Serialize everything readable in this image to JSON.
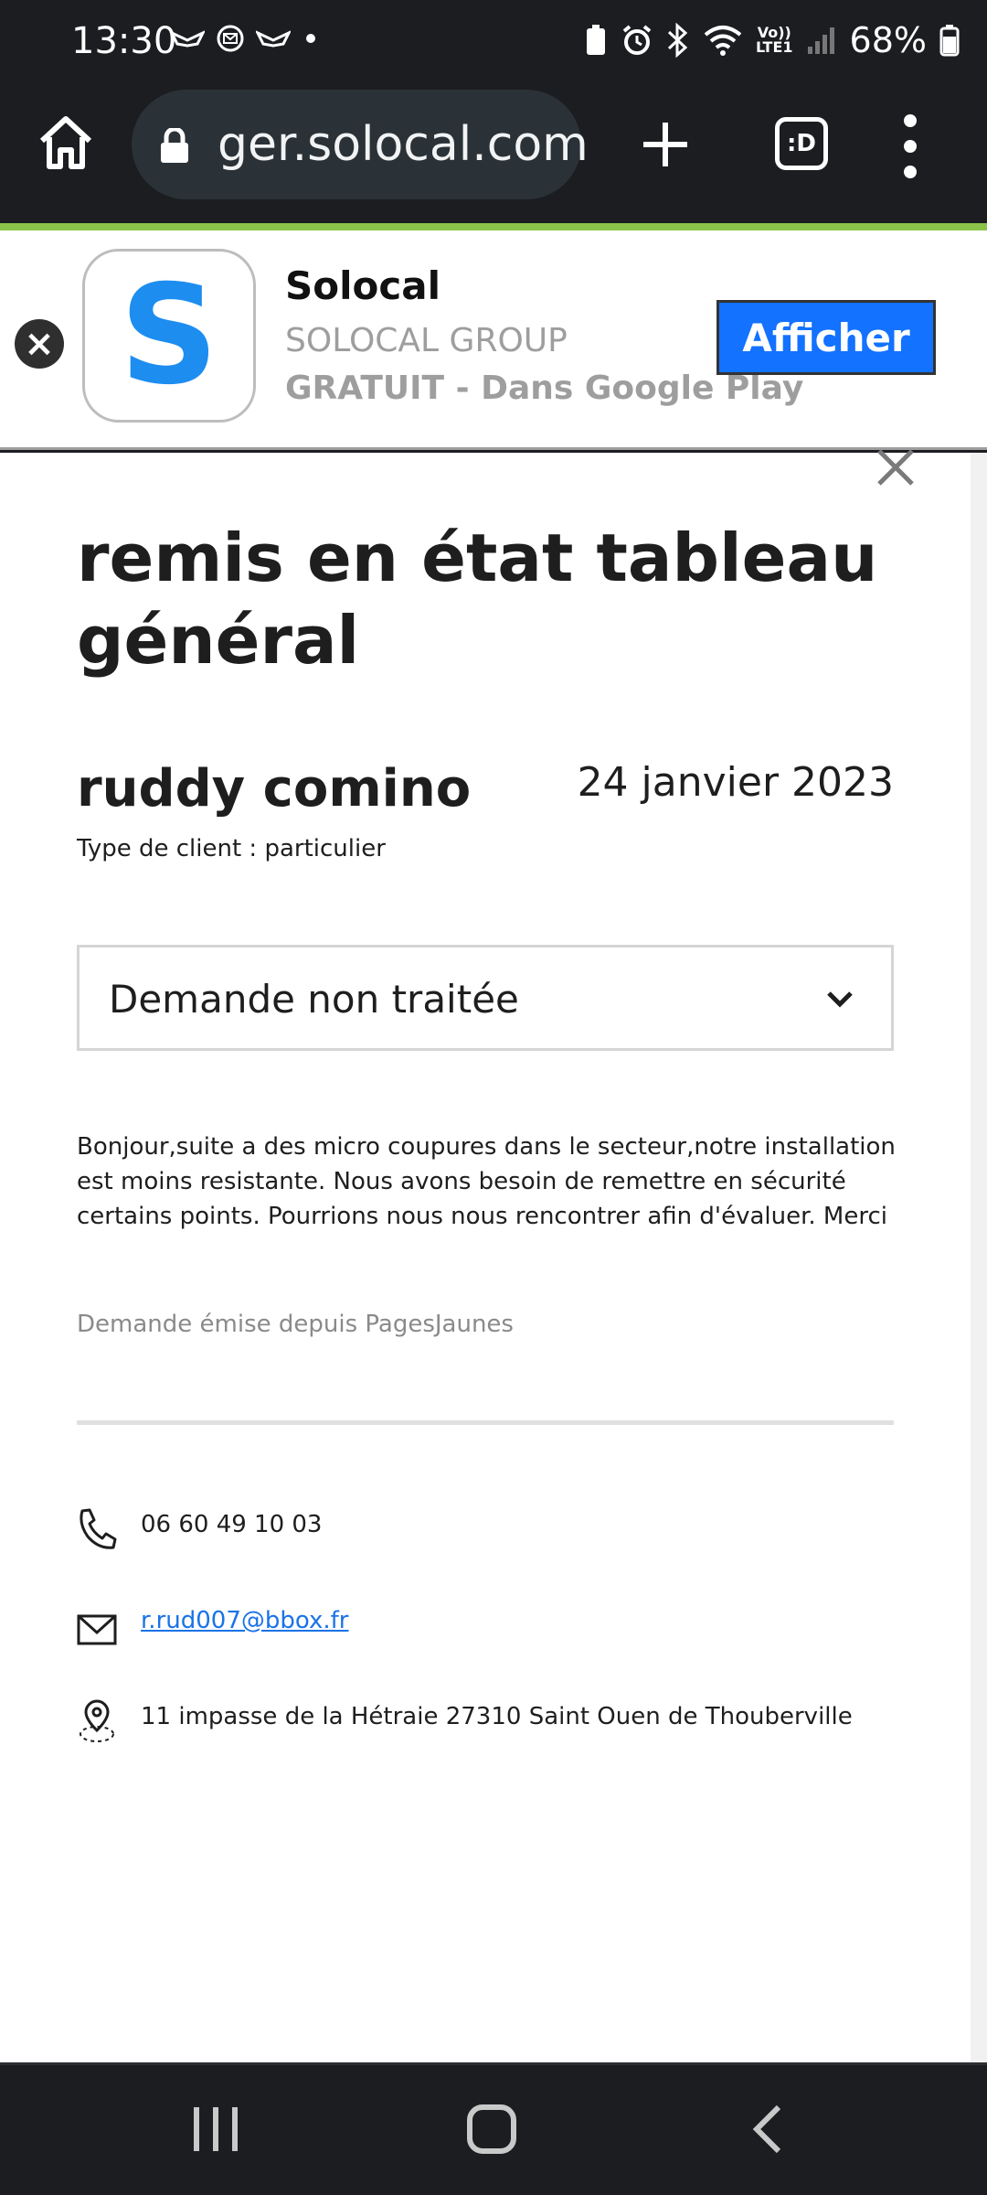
{
  "status_bar": {
    "time": "13:30",
    "battery": "68%",
    "icons": [
      "notification-icon",
      "mail-icon",
      "notification-icon",
      "dot-icon",
      "battery-saver-icon",
      "alarm-icon",
      "bluetooth-icon",
      "wifi-icon",
      "volte-icon",
      "signal-icon",
      "battery-icon"
    ],
    "volte_label": "Vo))\nLTE1"
  },
  "browser": {
    "url": "ger.solocal.com",
    "tabs_label": ":D"
  },
  "app_banner": {
    "app_name": "Solocal",
    "company": "SOLOCAL GROUP",
    "price": "GRATUIT - Dans Google Play",
    "action": "Afficher",
    "icon_letter": "S",
    "accent": "#1372ff"
  },
  "request": {
    "title": "remis en état tableau général",
    "client_name": "ruddy comino",
    "date": "24 janvier 2023",
    "client_type": "Type de client : particulier",
    "status": "Demande non traitée",
    "message": "Bonjour,suite a des micro coupures dans le secteur,notre installation est moins resistante. Nous avons besoin de remettre en sécurité certains points. Pourrions nous nous rencontrer afin d'évaluer. Merci",
    "source": "Demande émise depuis PagesJaunes"
  },
  "contact": {
    "phone": "06 60 49 10 03",
    "email": "r.rud007@bbox.fr",
    "address": "11 impasse de la Hétraie 27310 Saint Ouen de Thouberville"
  }
}
